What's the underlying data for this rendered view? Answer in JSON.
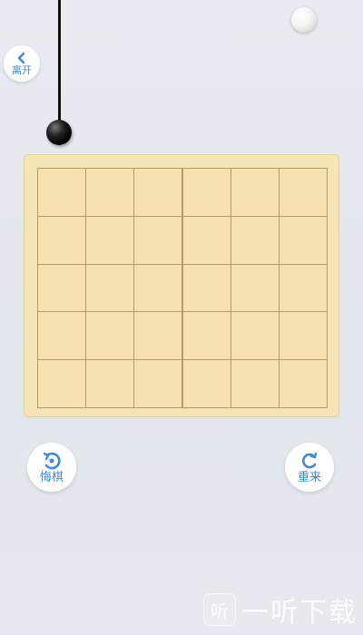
{
  "controls": {
    "back_label": "离开",
    "undo_label": "悔棋",
    "restart_label": "重来"
  },
  "board": {
    "rows": 5,
    "cols": 6
  },
  "watermark": {
    "logo_char": "听",
    "text": "一听下载"
  },
  "colors": {
    "accent": "#3f8ad8",
    "board": "#f5e4b5",
    "grid_line": "#b49a67",
    "background": "#e3e7ee"
  }
}
